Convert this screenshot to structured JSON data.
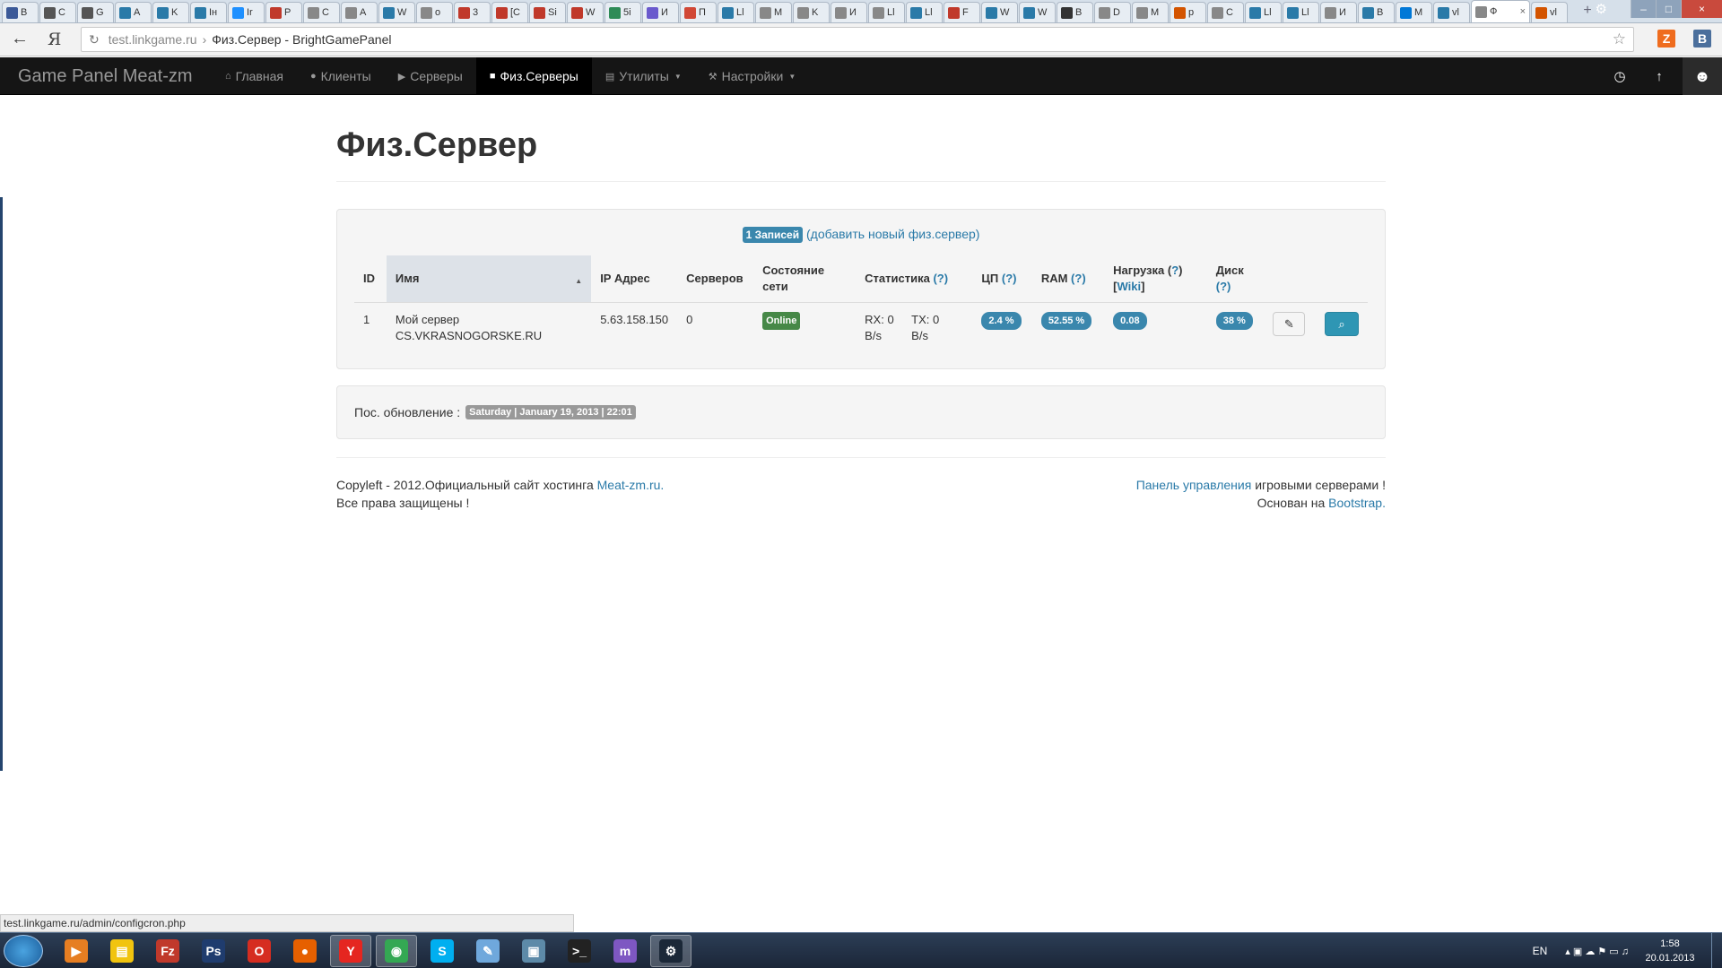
{
  "browser": {
    "tabs": [
      {
        "label": "B",
        "color": "#3b5998"
      },
      {
        "label": "C",
        "color": "#555"
      },
      {
        "label": "G",
        "color": "#555"
      },
      {
        "label": "A",
        "color": "#2a7aa8"
      },
      {
        "label": "K",
        "color": "#2a7aa8"
      },
      {
        "label": "Iн",
        "color": "#2a7aa8"
      },
      {
        "label": "Ir",
        "color": "#1e90ff"
      },
      {
        "label": "P",
        "color": "#c0392b"
      },
      {
        "label": "C",
        "color": "#888"
      },
      {
        "label": "A",
        "color": "#888"
      },
      {
        "label": "W",
        "color": "#2a7aa8"
      },
      {
        "label": "o",
        "color": "#888"
      },
      {
        "label": "3",
        "color": "#c0392b"
      },
      {
        "label": "[C",
        "color": "#c0392b"
      },
      {
        "label": "Si",
        "color": "#c0392b"
      },
      {
        "label": "W",
        "color": "#c0392b"
      },
      {
        "label": "5i",
        "color": "#2e8b57"
      },
      {
        "label": "И",
        "color": "#6a5acd"
      },
      {
        "label": "П",
        "color": "#d14836"
      },
      {
        "label": "Ll",
        "color": "#2a7aa8"
      },
      {
        "label": "M",
        "color": "#888"
      },
      {
        "label": "K",
        "color": "#888"
      },
      {
        "label": "И",
        "color": "#888"
      },
      {
        "label": "Ll",
        "color": "#888"
      },
      {
        "label": "Ll",
        "color": "#2a7aa8"
      },
      {
        "label": "F",
        "color": "#c0392b"
      },
      {
        "label": "W",
        "color": "#2a7aa8"
      },
      {
        "label": "W",
        "color": "#2a7aa8"
      },
      {
        "label": "B",
        "color": "#333"
      },
      {
        "label": "D",
        "color": "#888"
      },
      {
        "label": "M",
        "color": "#888"
      },
      {
        "label": "p",
        "color": "#d35400"
      },
      {
        "label": "C",
        "color": "#888"
      },
      {
        "label": "Ll",
        "color": "#2a7aa8"
      },
      {
        "label": "Ll",
        "color": "#2a7aa8"
      },
      {
        "label": "И",
        "color": "#888"
      },
      {
        "label": "B",
        "color": "#2a7aa8"
      },
      {
        "label": "M",
        "color": "#0078d7"
      },
      {
        "label": "vl",
        "color": "#2a7aa8"
      }
    ],
    "active_tab": {
      "label": "Ф",
      "close": "×"
    },
    "extra_tab": {
      "label": "vl"
    },
    "new_tab": "+",
    "window_controls": {
      "min": "–",
      "max": "□",
      "close": "×"
    },
    "settings_glyph": "⚙",
    "back_glyph": "←",
    "yandex_glyph": "Я",
    "reload_glyph": "↻",
    "url_host": "test.linkgame.ru",
    "url_sep": "›",
    "page_title": "Физ.Сервер - BrightGamePanel",
    "star_glyph": "☆",
    "ext1": "Z",
    "ext2": "B",
    "status_url": "test.linkgame.ru/admin/configcron.php"
  },
  "navbar": {
    "brand": "Game Panel Meat-zm",
    "items": [
      {
        "label": "Главная",
        "icon": "⌂"
      },
      {
        "label": "Клиенты",
        "icon": "●"
      },
      {
        "label": "Серверы",
        "icon": "▶"
      },
      {
        "label": "Физ.Серверы",
        "icon": "■"
      },
      {
        "label": "Утилиты",
        "icon": "▤",
        "caret": "▼"
      },
      {
        "label": "Настройки",
        "icon": "⚒",
        "caret": "▼"
      }
    ],
    "right": {
      "clock": "◷",
      "up": "↑",
      "user": "☻"
    }
  },
  "page": {
    "heading": "Физ.Сервер",
    "records_badge": "1 Записей",
    "add_link": "(добавить новый физ.сервер)",
    "table": {
      "headers": {
        "id": "ID",
        "name": "Имя",
        "sort_arrow": "▲",
        "ip": "IP Адрес",
        "servers": "Серверов",
        "net": "Состояние сети",
        "stats": "Статистика",
        "cpu": "ЦП",
        "ram": "RAM",
        "load": "Нагрузка",
        "disk": "Диск",
        "help": "(?)",
        "help_q": "?",
        "wiki": "Wiki"
      },
      "row": {
        "id": "1",
        "name": "Мой сервер CS.VKRASNOGORSKE.RU",
        "ip": "5.63.158.150",
        "servers": "0",
        "net_status": "Online",
        "rx": "RX: 0 B/s",
        "tx": "TX: 0 B/s",
        "cpu": "2.4 %",
        "ram": "52.55 %",
        "load": "0.08",
        "disk": "38 %",
        "edit_icon": "✎",
        "view_icon": "⌕"
      }
    },
    "last_update_label": "Пос. обновление :",
    "last_update_value": "Saturday | January 19, 2013 | 22:01"
  },
  "footer": {
    "left_line1_prefix": "Copyleft - 2012.Официальный сайт хостинга ",
    "left_link": "Meat-zm.ru.",
    "left_line2": "Все права защищены !",
    "right_link1": "Панель управления",
    "right_line1_suffix": " игровыми серверами !",
    "right_line2_prefix": "Основан на ",
    "right_link2": "Bootstrap."
  },
  "taskbar": {
    "apps": [
      {
        "name": "media-player",
        "glyph": "▶",
        "color": "#e67e22"
      },
      {
        "name": "explorer",
        "glyph": "▤",
        "color": "#f1c40f"
      },
      {
        "name": "filezilla",
        "glyph": "Fz",
        "color": "#c0392b"
      },
      {
        "name": "photoshop",
        "glyph": "Ps",
        "color": "#1f3c6e"
      },
      {
        "name": "opera",
        "glyph": "O",
        "color": "#d62d20"
      },
      {
        "name": "firefox",
        "glyph": "●",
        "color": "#e66000"
      },
      {
        "name": "yandex",
        "glyph": "Y",
        "color": "#e52620"
      },
      {
        "name": "chrome",
        "glyph": "◉",
        "color": "#34a853"
      },
      {
        "name": "skype",
        "glyph": "S",
        "color": "#00aff0"
      },
      {
        "name": "notepad",
        "glyph": "✎",
        "color": "#6fa8dc"
      },
      {
        "name": "network",
        "glyph": "▣",
        "color": "#5d8aa8"
      },
      {
        "name": "terminal",
        "glyph": ">_",
        "color": "#222"
      },
      {
        "name": "app-m",
        "glyph": "m",
        "color": "#7e57c2"
      },
      {
        "name": "steam",
        "glyph": "⚙",
        "color": "#1b2838"
      }
    ],
    "lang": "EN",
    "tray_icons": "▴  ▣  ☁  ⚑  ▭  ♫",
    "time": "1:58",
    "date": "20.01.2013"
  }
}
